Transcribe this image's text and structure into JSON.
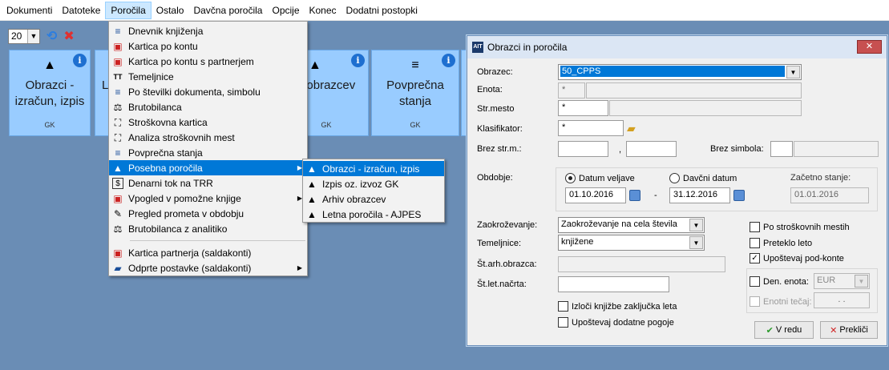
{
  "menubar": [
    "Dokumenti",
    "Datoteke",
    "Poročila",
    "Ostalo",
    "Davčna poročila",
    "Opcije",
    "Konec",
    "Dodatni postopki"
  ],
  "toolbar": {
    "count": "20",
    "refresh_icon": "refresh-icon",
    "close_icon": "close-icon"
  },
  "tiles": [
    {
      "label1": "Obrazci -",
      "label2": "izračun, izpis",
      "foot": "GK"
    },
    {
      "label1": "L",
      "label2": "",
      "foot": ""
    },
    {
      "label1": "v obrazcev",
      "label2": "",
      "foot": "GK"
    },
    {
      "label1": "Povprečna",
      "label2": "stanja",
      "foot": "GK"
    }
  ],
  "dropdown": [
    {
      "label": "Dnevnik knjiženja",
      "icon": "≡"
    },
    {
      "label": "Kartica po kontu",
      "icon": "▣"
    },
    {
      "label": "Kartica po kontu s partnerjem",
      "icon": "▣"
    },
    {
      "label": "Temeljnice",
      "icon": "TT"
    },
    {
      "label": "Po številki dokumenta, simbolu",
      "icon": "≡"
    },
    {
      "label": "Brutobilanca",
      "icon": "⚖"
    },
    {
      "label": "Stroškovna kartica",
      "icon": "⛶"
    },
    {
      "label": "Analiza stroškovnih mest",
      "icon": "⛶"
    },
    {
      "label": "Povprečna stanja",
      "icon": "≡"
    },
    {
      "label": "Posebna poročila",
      "icon": "▲"
    },
    {
      "label": "Denarni tok na TRR",
      "icon": "$"
    },
    {
      "label": "Vpogled v pomožne knjige",
      "icon": "▣"
    },
    {
      "label": "Pregled prometa v obdobju",
      "icon": "✎"
    },
    {
      "label": "Brutobilanca z analitiko",
      "icon": "⚖"
    },
    {
      "label": "Kartica partnerja (saldakonti)",
      "icon": "▣"
    },
    {
      "label": "Odprte postavke (saldakonti)",
      "icon": "📂"
    }
  ],
  "submenu": [
    {
      "label": "Obrazci - izračun, izpis"
    },
    {
      "label": "Izpis oz. izvoz GK"
    },
    {
      "label": "Arhiv obrazcev"
    },
    {
      "label": "Letna poročila - AJPES"
    }
  ],
  "dialog": {
    "title": "Obrazci in poročila",
    "close": "✕",
    "labels": {
      "obrazec": "Obrazec:",
      "enota": "Enota:",
      "strmesto": "Str.mesto",
      "klasifikator": "Klasifikator:",
      "brez_strm": "Brez str.m.:",
      "brez_simbola": "Brez simbola:",
      "obdobje": "Obdobje:",
      "zaokrozevanje": "Zaokroževanje:",
      "temeljnice": "Temeljnice:",
      "starh": "Št.arh.obrazca:",
      "stlet": "Št.let.načrta:",
      "comma": ","
    },
    "values": {
      "obrazec": "50_CPPS",
      "enota": "*",
      "strmesto": "*",
      "klasifikator": "*",
      "date_from": "01.10.2016",
      "date_to": "31.12.2016",
      "zacetno": "01.01.2016",
      "dash": "-",
      "zaokrozevanje": "Zaokroževanje na cela števila",
      "temeljnice": "knjižene",
      "valuta": "EUR",
      "tecaj": ". ."
    },
    "radio_datum": "Datum veljave",
    "radio_davcni": "Davčni datum",
    "zacetno_label": "Začetno stanje:",
    "checks": {
      "po_strm": "Po stroškovnih mestih",
      "preteklo": "Preteklo leto",
      "podkonte": "Upoštevaj pod-konte",
      "den_enota": "Den. enota:",
      "enotni": "Enotni tečaj:",
      "izloci": "Izloči knjižbe zaključka leta",
      "dodatne": "Upoštevaj dodatne pogoje"
    },
    "buttons": {
      "ok": "V redu",
      "cancel": "Prekliči"
    }
  }
}
